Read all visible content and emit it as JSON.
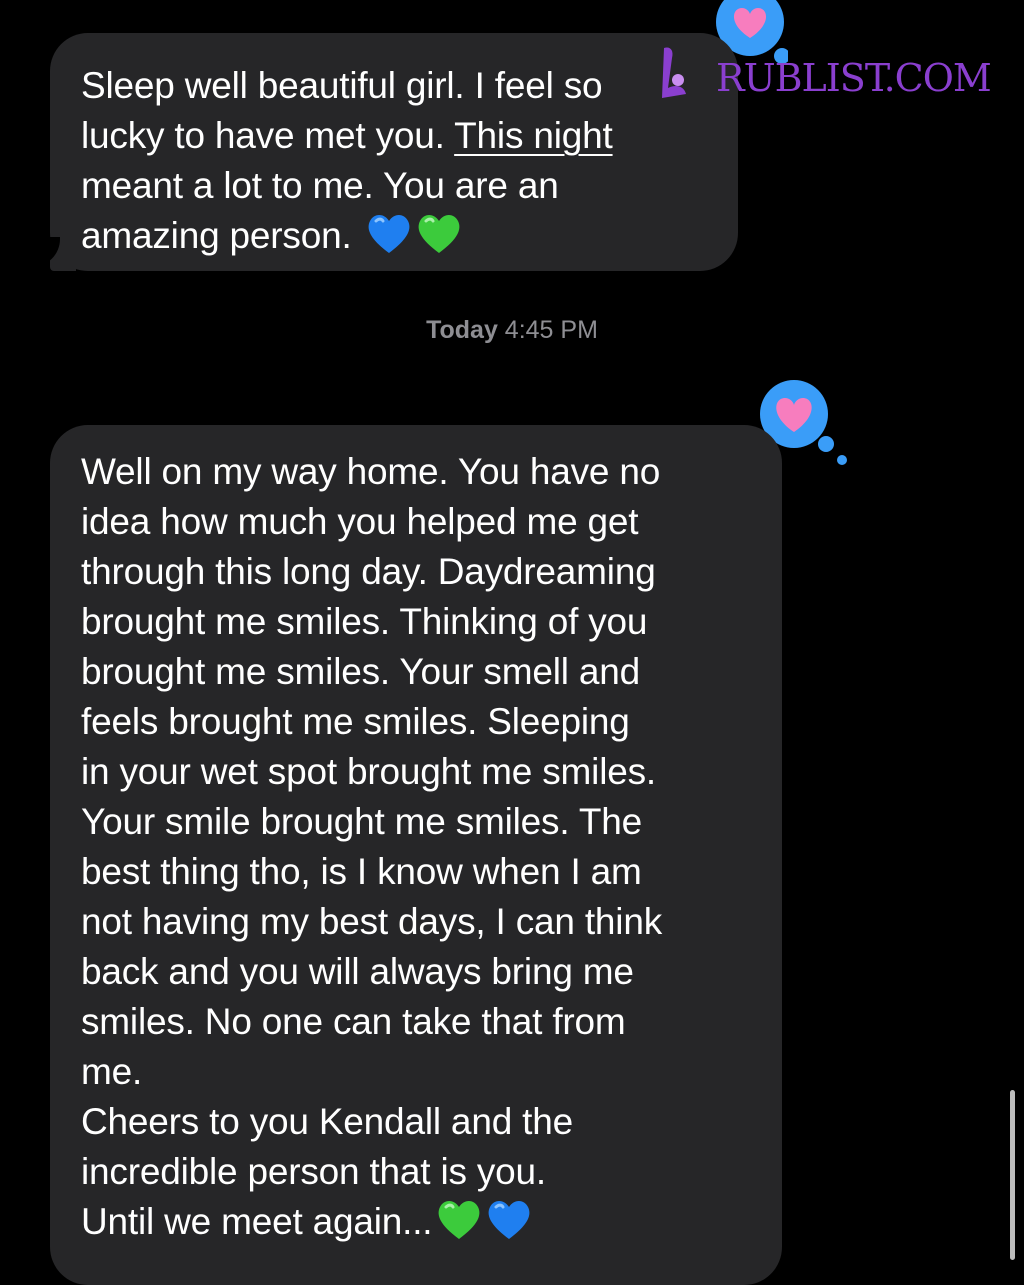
{
  "conversation": {
    "messages": [
      {
        "lines": [
          "Sleep well beautiful girl. I feel so",
          "lucky to have met you. ",
          "meant a lot to me.  You are an",
          "amazing person. "
        ],
        "underlined_link": "This night",
        "emojis": [
          "blue-heart",
          "green-heart"
        ],
        "tapback": "heart"
      },
      {
        "lines": [
          "Well on my way home. You have no",
          "idea how much you helped me get",
          "through this long day. Daydreaming",
          "brought me smiles. Thinking of you",
          "brought me smiles. Your smell and",
          "feels brought me smiles. Sleeping",
          "in your wet spot brought me smiles.",
          "Your smile brought me smiles. The",
          "best thing tho, is I know when I am",
          "not having my best days, I can think",
          "back and you will always bring me",
          "smiles. No one can take that from",
          "me.",
          "Cheers to you Kendall and the",
          "incredible person that is you.",
          "Until we meet again..."
        ],
        "emojis": [
          "green-heart",
          "blue-heart"
        ],
        "tapback": "heart"
      }
    ],
    "timestamp_day": "Today",
    "timestamp_time": "4:45 PM"
  },
  "watermark": {
    "text": "RUBLIST.COM"
  },
  "colors": {
    "background": "#000000",
    "bubble": "#262628",
    "text": "#ffffff",
    "timestamp": "#8e8e93",
    "tapback_bubble": "#3a9df8",
    "tapback_heart": "#f77dbe",
    "watermark": "#8a3fcf",
    "blue_heart": "#1f7ff0",
    "green_heart": "#3ccb3c"
  }
}
